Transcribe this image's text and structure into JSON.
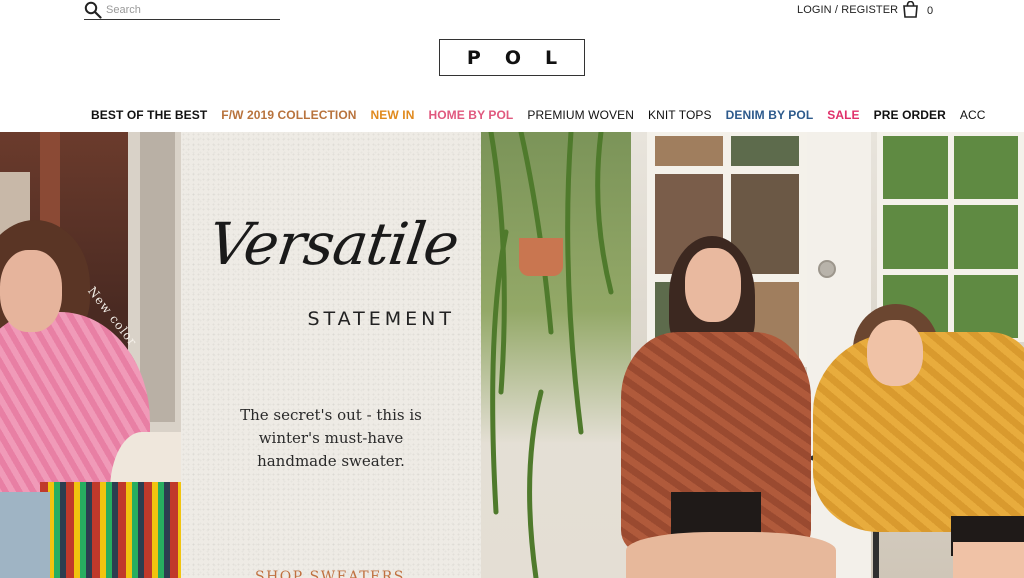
{
  "header": {
    "search": {
      "placeholder": "Search"
    },
    "account_label": "LOGIN / REGISTER",
    "cart_count": "0",
    "logo_text": "POL"
  },
  "nav": {
    "items": [
      {
        "label": "BEST OF THE BEST",
        "color": "#111111",
        "bold": true
      },
      {
        "label": "F/W 2019 COLLECTION",
        "color": "#b8733d",
        "bold": true
      },
      {
        "label": "NEW IN",
        "color": "#e08a1e",
        "bold": true
      },
      {
        "label": "HOME BY POL",
        "color": "#e0587e",
        "bold": true
      },
      {
        "label": "PREMIUM WOVEN",
        "color": "#111111",
        "bold": false
      },
      {
        "label": "KNIT TOPS",
        "color": "#111111",
        "bold": false
      },
      {
        "label": "DENIM BY POL",
        "color": "#2d5a8c",
        "bold": true
      },
      {
        "label": "SALE",
        "color": "#e0306a",
        "bold": true
      },
      {
        "label": "PRE ORDER",
        "color": "#111111",
        "bold": true
      },
      {
        "label": "ACC",
        "color": "#111111",
        "bold": false
      }
    ]
  },
  "hero": {
    "badge_text": "New color",
    "script_title": "Versatile",
    "subtitle": "STATEMENT",
    "tagline_lines": [
      "The secret's out - this is",
      "winter's must-have",
      "handmade sweater."
    ],
    "cta_label": "SHOP SWEATERS",
    "accent_color": "#c0703f"
  }
}
